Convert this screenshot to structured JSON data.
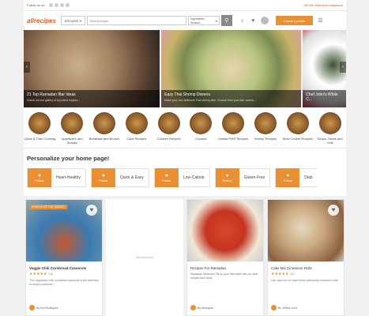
{
  "topbar": {
    "follow_label": "Follow us on:",
    "social": [
      "facebook-icon",
      "pinterest-icon",
      "twitter-icon",
      "instagram-icon"
    ],
    "magazine_link": "Get the Allrecipes magazine"
  },
  "header": {
    "logo": "allrecipes",
    "browse_label": "BROWSE",
    "search_placeholder": "Find a recipe",
    "ingredient_label": "Ingredient Search",
    "create_label": "Create a profile"
  },
  "hero": [
    {
      "title": "21 Top Ramadan Iftar Ideas",
      "desc": "Check out our gallery of top-rated recipes..."
    },
    {
      "title": "Easy Thai Shrimp Dinners",
      "desc": "Make your own delicious Thai shrimp dish. Choose from pad thai, curries..."
    },
    {
      "title": "Chef John's White C...",
      "desc": ""
    }
  ],
  "categories": [
    {
      "label": "Quick & Time Cooking"
    },
    {
      "label": "Appetizers and Snacks"
    },
    {
      "label": "Breakfast and Brunch"
    },
    {
      "label": "Cake Recipes"
    },
    {
      "label": "Chicken Recipes"
    },
    {
      "label": "Cookies"
    },
    {
      "label": "Instant Pot® Recipes"
    },
    {
      "label": "Shrimp Recipes"
    },
    {
      "label": "Slow Cooker Recipes"
    },
    {
      "label": "Soups, Stews and Chili"
    }
  ],
  "personalize": {
    "title": "Personalize your home page!",
    "follow_label": "Follow",
    "prefs": [
      "Heart-Healthy",
      "Quick & Easy",
      "Low-Calorie",
      "Gluten-Free",
      "Diab"
    ]
  },
  "cards": [
    {
      "badge": "PEOPLE OF THE MONTH",
      "title": "Veggie Chili Cornbread Casserole",
      "stars": "★★★★★",
      "count": "119",
      "desc": "This vegetarian chili cornbread casserole is the best dish to bring to potlucks...",
      "by": "By Sisi Rodriguez"
    },
    {
      "title": "Recipes For Ramadan",
      "desc": "Ramadan Mubarak! Fill up your Iftar table with our best recipes and ideas.",
      "by": "By Allrecipes"
    },
    {
      "title": "Cake Mix Cinnamon Rolls",
      "stars": "★★★★★",
      "count": "207",
      "desc": "Use cake mix to make these fabulously cinnamon rolls.",
      "by": "By Jeffrey Hunt"
    }
  ],
  "ad_label": "Advertisement"
}
